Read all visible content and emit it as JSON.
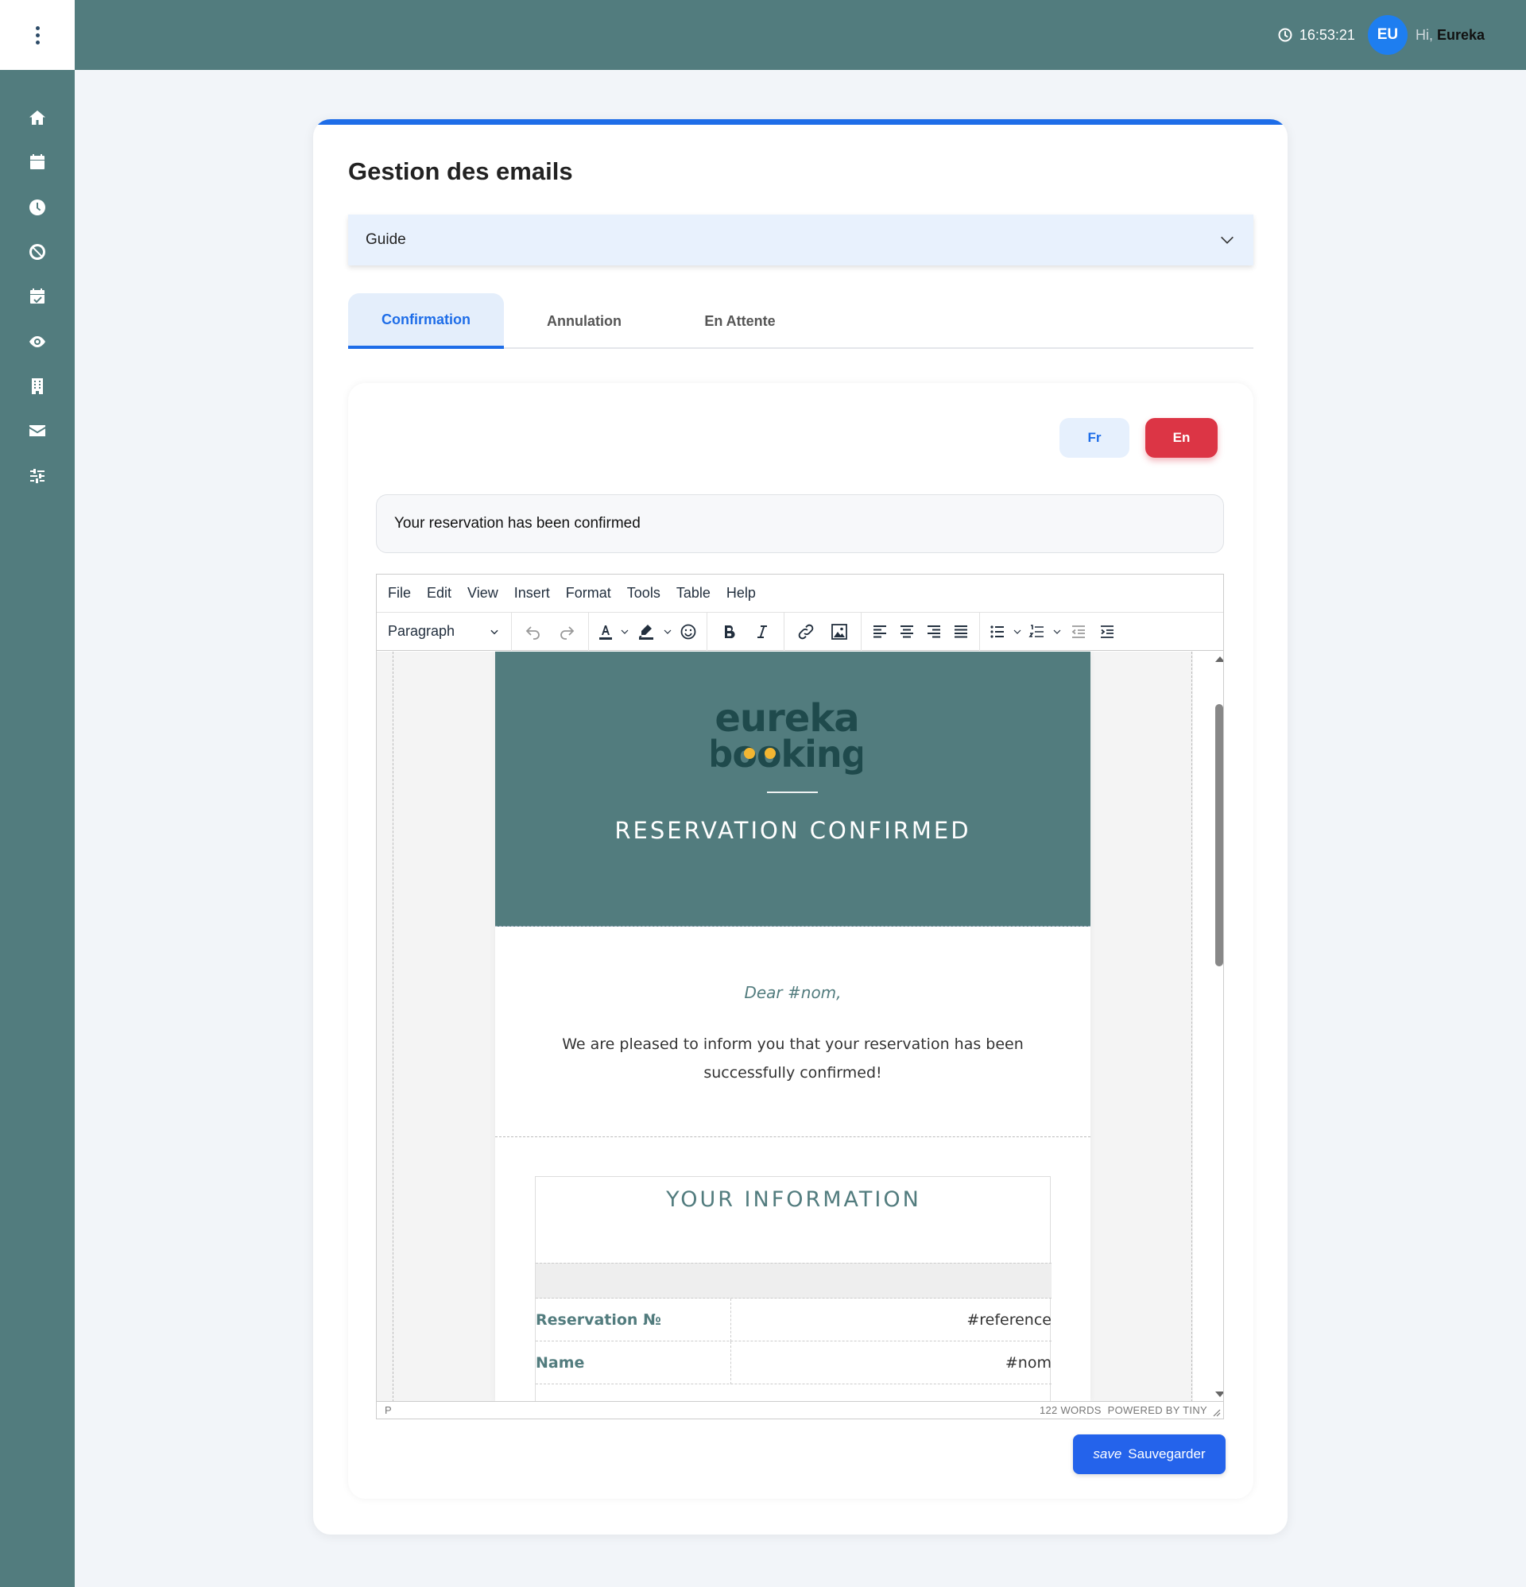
{
  "topbar": {
    "time": "16:53:21",
    "avatar_initials": "EU",
    "greeting": "Hi,",
    "user_name": "Eureka",
    "bg_color": "#527c7e",
    "avatar_color": "#1e7ef0"
  },
  "sidebar": {
    "menu_icon": "kebab-menu-icon",
    "items": [
      {
        "icon": "home-icon"
      },
      {
        "icon": "calendar-icon"
      },
      {
        "icon": "clock-icon"
      },
      {
        "icon": "ban-icon"
      },
      {
        "icon": "calendar-check-icon"
      },
      {
        "icon": "eye-icon"
      },
      {
        "icon": "building-icon"
      },
      {
        "icon": "mail-icon"
      },
      {
        "icon": "sliders-icon"
      }
    ]
  },
  "page": {
    "title": "Gestion des emails",
    "guide_label": "Guide",
    "accent_color": "#1e6de8"
  },
  "tabs": [
    {
      "label": "Confirmation",
      "active": true
    },
    {
      "label": "Annulation",
      "active": false
    },
    {
      "label": "En Attente",
      "active": false
    }
  ],
  "language": {
    "fr_label": "Fr",
    "en_label": "En",
    "selected": "En"
  },
  "subject": {
    "value": "Your reservation has been confirmed"
  },
  "editor": {
    "menus": [
      "File",
      "Edit",
      "View",
      "Insert",
      "Format",
      "Tools",
      "Table",
      "Help"
    ],
    "block_format": "Paragraph",
    "status_path": "P",
    "word_count": "122 WORDS",
    "powered_by": "POWERED BY TINY"
  },
  "email": {
    "logo_line1": "eureka",
    "logo_line2": "booking",
    "header_title": "RESERVATION CONFIRMED",
    "greeting": "Dear #nom,",
    "message": "We are pleased to inform you that your reservation has been successfully confirmed!",
    "info_title": "YOUR INFORMATION",
    "info_rows": [
      {
        "label": "Reservation №",
        "value": "#reference"
      },
      {
        "label": "Name",
        "value": "#nom"
      }
    ]
  },
  "actions": {
    "save_icon_text": "save",
    "save_label": "Sauvegarder"
  }
}
